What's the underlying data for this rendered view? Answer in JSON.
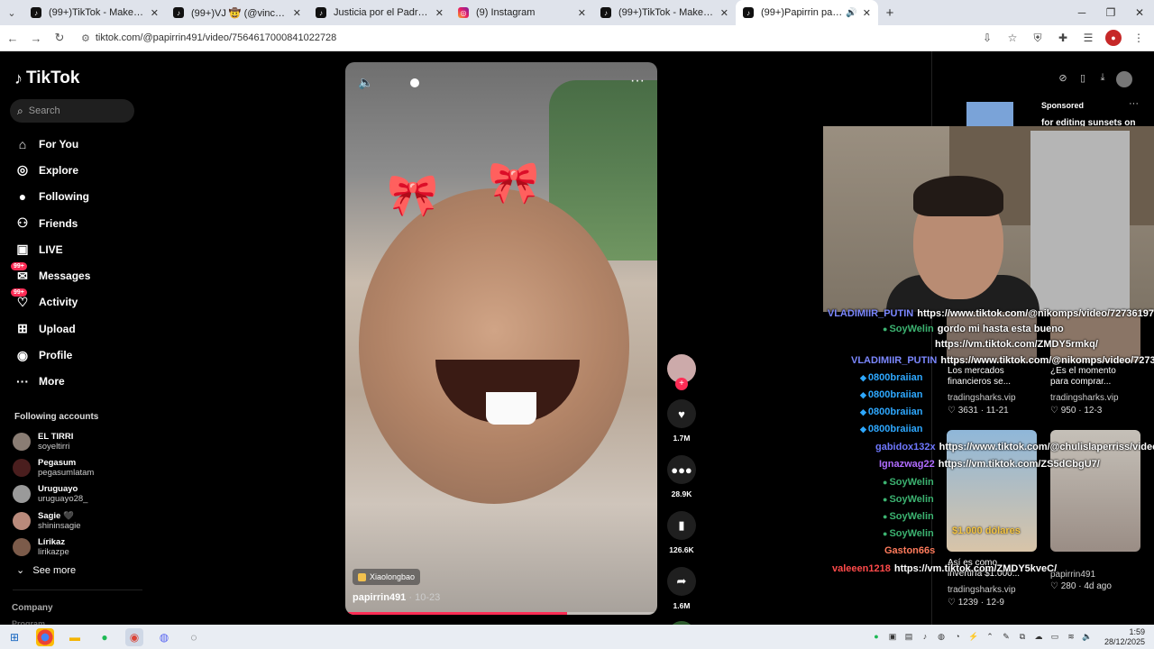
{
  "browser": {
    "tabs": [
      {
        "label": "(99+)TikTok - Make Your Day",
        "icon": "tiktok-icon"
      },
      {
        "label": "(99+)VJ 🤠 (@vincentevincente",
        "icon": "tiktok-icon"
      },
      {
        "label": "Justicia por el Padre: Homenaje",
        "icon": "tiktok-icon"
      },
      {
        "label": "(9) Instagram",
        "icon": "instagram-icon"
      },
      {
        "label": "(99+)TikTok - Make Your Day",
        "icon": "tiktok-icon"
      },
      {
        "label": "(99+)Papirrin papirrin (@pa",
        "icon": "tiktok-icon",
        "active": true
      }
    ],
    "url": "tiktok.com/@papirrin491/video/7564617000841022728"
  },
  "tiktok": {
    "logo": "TikTok",
    "search_placeholder": "Search",
    "menu": [
      {
        "label": "For You",
        "icon": "home-icon"
      },
      {
        "label": "Explore",
        "icon": "compass-icon"
      },
      {
        "label": "Following",
        "icon": "avatar-icon"
      },
      {
        "label": "Friends",
        "icon": "friends-icon"
      },
      {
        "label": "LIVE",
        "icon": "live-icon"
      },
      {
        "label": "Messages",
        "icon": "messages-icon",
        "badge": "99+"
      },
      {
        "label": "Activity",
        "icon": "activity-icon",
        "badge": "99+"
      },
      {
        "label": "Upload",
        "icon": "upload-icon"
      },
      {
        "label": "Profile",
        "icon": "profile-icon"
      },
      {
        "label": "More",
        "icon": "more-icon"
      }
    ],
    "following_header": "Following accounts",
    "following": [
      {
        "name": "EL TIRRI",
        "user": "soyeltirri"
      },
      {
        "name": "Pegasum",
        "user": "pegasumlatam"
      },
      {
        "name": "Uruguayo",
        "user": "uruguayo28_"
      },
      {
        "name": "Sagie 🖤",
        "user": "shininsagie"
      },
      {
        "name": "Lírikaz",
        "user": "lirikazpe"
      }
    ],
    "see_more": "See more",
    "company": "Company",
    "program": "Program"
  },
  "video": {
    "effect": "Xiaolongbao",
    "author": "papirrin491",
    "date": "· 10-23",
    "progress": 0.71,
    "likes": "1.7M",
    "comments": "28.9K",
    "saves": "126.6K",
    "shares": "1.6M"
  },
  "right": {
    "sponsored": "Sponsored",
    "sponsored_title": "for editing sunsets on",
    "cards": [
      {
        "title_1": "Los mercados",
        "title_2": "financieros se...",
        "user": "tradingsharks.vip",
        "likes": "3631",
        "date": "11-21"
      },
      {
        "title_1": "¿Es el momento",
        "title_2": "para comprar...",
        "user": "tradingsharks.vip",
        "likes": "950",
        "date": "12-3"
      },
      {
        "title_1": "Así es como",
        "title_2": "invertiría $1.000...",
        "user": "tradingsharks.vip",
        "likes": "1239",
        "date": "12-9"
      },
      {
        "title_1": "",
        "title_2": "",
        "user": "papirrin491",
        "likes": "280",
        "date": "4d ago"
      }
    ],
    "card_overlay": "$1.000 dólares"
  },
  "chat": [
    {
      "name": "VLADIMIIR_PUTIN",
      "color": "#7b87ff",
      "msg": "https://www.tiktok.com/@nikomps/video/72736197"
    },
    {
      "name": "SoyWelin",
      "color": "#3cb371",
      "badge": "green",
      "msg": "gordo mi hasta esta bueno"
    },
    {
      "name": "",
      "color": "#fff",
      "msg": "https://vm.tiktok.com/ZMDY5rmkq/"
    },
    {
      "name": "VLADIMIIR_PUTIN",
      "color": "#7b87ff",
      "msg": "https://www.tiktok.com/@nikomps/video/72736197"
    },
    {
      "name": "0800braiian",
      "color": "#2ea8ff",
      "badge": "diamond",
      "msg": ""
    },
    {
      "name": "0800braiian",
      "color": "#2ea8ff",
      "badge": "diamond",
      "msg": ""
    },
    {
      "name": "0800braiian",
      "color": "#2ea8ff",
      "badge": "diamond",
      "msg": ""
    },
    {
      "name": "0800braiian",
      "color": "#2ea8ff",
      "badge": "diamond",
      "msg": ""
    },
    {
      "name": "gabidox132x",
      "color": "#6f78ff",
      "msg": "https://www.tiktok.com/@chulislaperriss/video/7577"
    },
    {
      "name": "Ignazwag22",
      "color": "#b06cff",
      "msg": "https://vm.tiktok.com/ZS5dCbgU7/"
    },
    {
      "name": "SoyWelin",
      "color": "#3cb371",
      "badge": "green",
      "msg": ""
    },
    {
      "name": "SoyWelin",
      "color": "#3cb371",
      "badge": "green",
      "msg": ""
    },
    {
      "name": "SoyWelin",
      "color": "#3cb371",
      "badge": "green",
      "msg": ""
    },
    {
      "name": "SoyWelin",
      "color": "#3cb371",
      "badge": "green",
      "msg": ""
    },
    {
      "name": "Gaston66s",
      "color": "#ff7b5c",
      "msg": ""
    },
    {
      "name": "valeeen1218",
      "color": "#ff4a4a",
      "msg": "https://vm.tiktok.com/ZMDY5kveC/"
    }
  ],
  "clock": {
    "time": "1:59",
    "date": "28/12/2025"
  },
  "colors": {
    "accent": "#fe2c55",
    "bg": "#000000"
  }
}
